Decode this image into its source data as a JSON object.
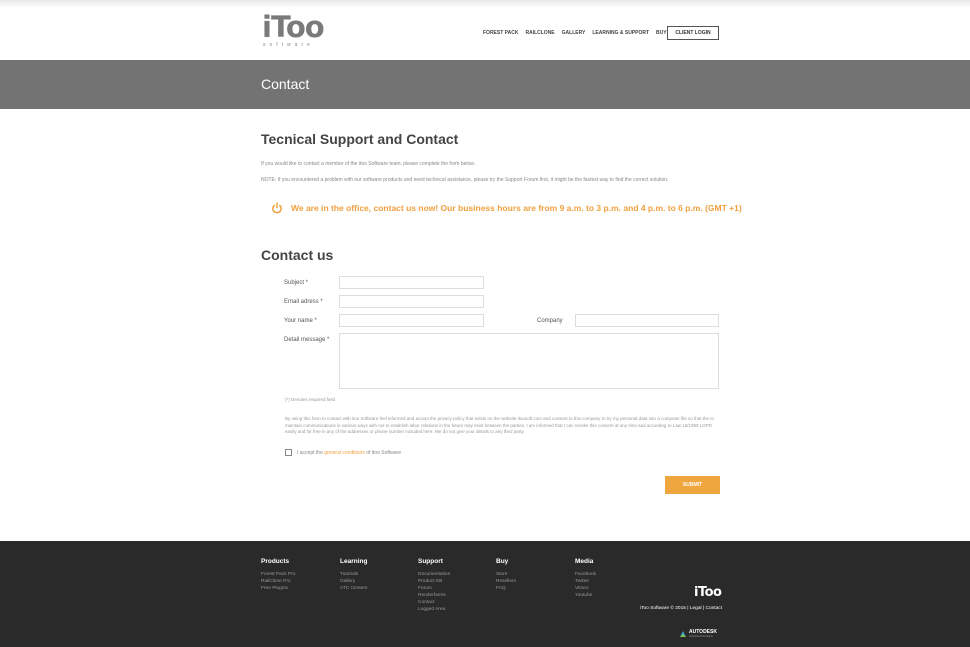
{
  "header": {
    "logo_main": "iToo",
    "logo_sub": "software",
    "nav": [
      "FOREST PACK",
      "RAILCLONE",
      "GALLERY",
      "LEARNING & SUPPORT",
      "BUY"
    ],
    "login": "CLIENT LOGIN"
  },
  "hero": {
    "title": "Contact"
  },
  "support": {
    "title": "Tecnical Support and Contact",
    "intro1": "If you would like to contact a member of the itoo Software team, please complete the form below.",
    "intro2": "NOTE: If you encountered a problem with our software products and need technical assistance, please try the Support Forum first, it might be the fastest way to find the correct solution.",
    "notice": "We are in the office, contact us now!  Our business hours are from 9 a.m. to 3 p.m. and 4 p.m. to 6 p.m. (GMT +1)"
  },
  "form": {
    "title": "Contact us",
    "subject": "Subject *",
    "email": "Email adress *",
    "name": "Your name *",
    "company": "Company",
    "message": "Detail message *",
    "required_note": "(*) Denotes required field",
    "legal": "By using this form to contact with itoo Software feel informed and accept the privacy policy that exists on the website itoosoft.com and consent to this company to try my personal data into a computer file so that the to maintain communications in various ways with me to establish labor relations in the future may exist between the parties. I am informed that I can revoke this consent at any time and according to Law 15/1999 LOPD easily and for free in any of the addresses or phone number included here. We do not give your details to any third party.",
    "accept_pre": "I accept the",
    "accept_link": "general conditions",
    "accept_post": "of itoo Software",
    "submit": "SUBMIT"
  },
  "footer": {
    "columns": [
      {
        "title": "Products",
        "items": [
          "Forest Pack Pro",
          "RailClone Pro",
          "Free Plugins"
        ]
      },
      {
        "title": "Learning",
        "items": [
          "Tutorials",
          "Gallery",
          "ATC Centers"
        ]
      },
      {
        "title": "Support",
        "items": [
          "Documentation",
          "Product KB",
          "Forum",
          "Renderfarms",
          "Contact",
          "Logged Area"
        ]
      },
      {
        "title": "Buy",
        "items": [
          "Store",
          "Resellers",
          "FAQ"
        ]
      },
      {
        "title": "Media",
        "items": [
          "Facebook",
          "Twitter",
          "Vimeo",
          "Youtube"
        ]
      }
    ],
    "logo": "iToo",
    "copyright": "iToo Software © 2015  |  Legal  |  Contact",
    "autodesk": "AUTODESK",
    "autodesk_sub": "Authorized Developer"
  },
  "colors": {
    "accent": "#f0a63e",
    "hero": "#737373",
    "footer": "#2a2a2a"
  }
}
